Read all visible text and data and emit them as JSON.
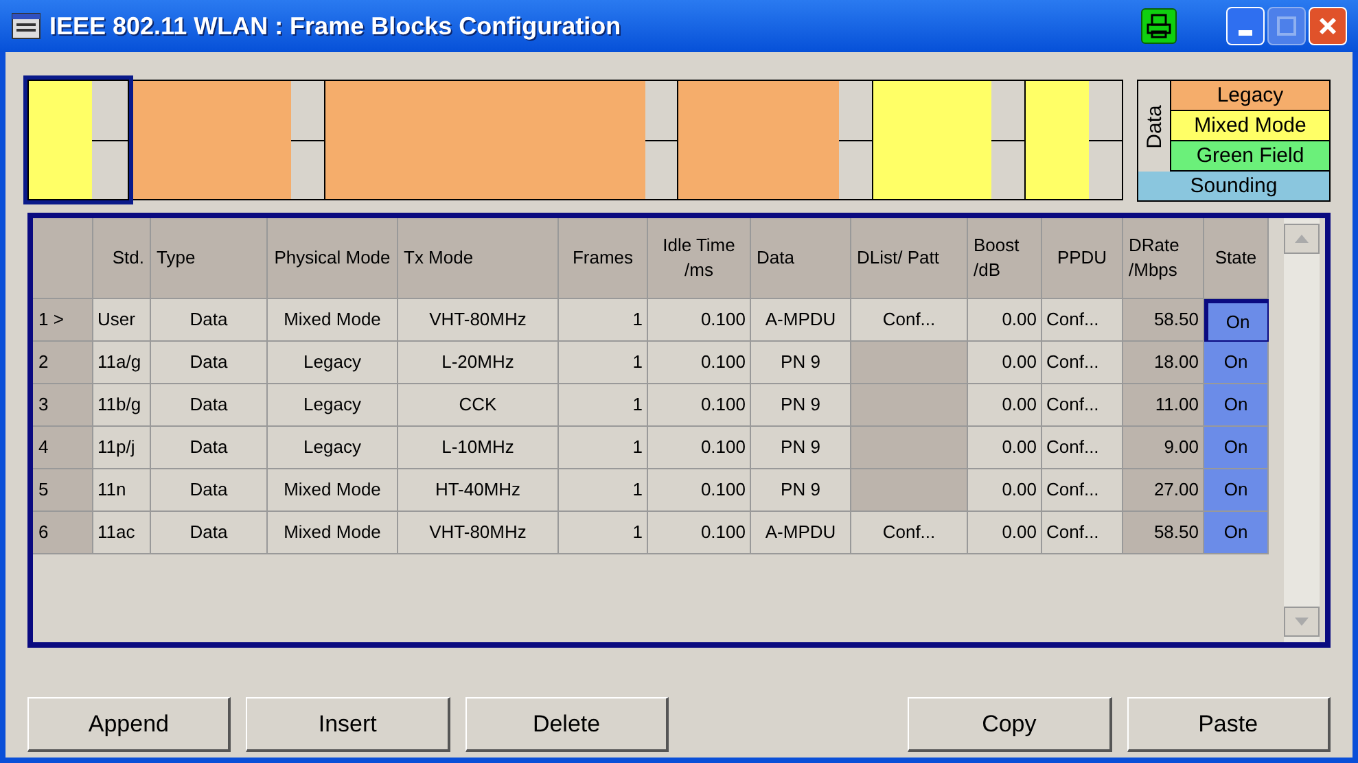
{
  "window": {
    "title": "IEEE 802.11 WLAN : Frame Blocks Configuration"
  },
  "frame_blocks": [
    {
      "color": "#ffff66",
      "selected": true
    },
    {
      "color": "#f5ad6b",
      "selected": false
    },
    {
      "color": "#f5ad6b",
      "selected": false
    },
    {
      "color": "#f5ad6b",
      "selected": false
    },
    {
      "color": "#ffff66",
      "selected": false
    },
    {
      "color": "#ffff66",
      "selected": false
    }
  ],
  "legend": {
    "group_label": "Data",
    "items": [
      {
        "label": "Legacy",
        "color": "#f5ad6b",
        "kind": "data"
      },
      {
        "label": "Mixed Mode",
        "color": "#ffff66",
        "kind": "data"
      },
      {
        "label": "Green Field",
        "color": "#6bf07a",
        "kind": "data"
      },
      {
        "label": "Sounding",
        "color": "#8ac6de",
        "kind": "other"
      }
    ]
  },
  "table": {
    "columns": [
      "Std.",
      "Type",
      "Physical Mode",
      "Tx Mode",
      "Frames",
      "Idle Time /ms",
      "Data",
      "DList/ Patt",
      "Boost /dB",
      "PPDU",
      "DRate /Mbps",
      "State"
    ],
    "rows": [
      {
        "label": "1 >",
        "selected": true,
        "std": "User",
        "type": "Data",
        "physical_mode": "Mixed Mode",
        "tx_mode": "VHT-80MHz",
        "frames": "1",
        "idle_time": "0.100",
        "data": "A-MPDU",
        "dlist_disabled": false,
        "dlist": "Conf...",
        "boost": "0.00",
        "ppdu": "Conf...",
        "drate": "58.50",
        "state": "On"
      },
      {
        "label": "2",
        "selected": false,
        "std": "11a/g",
        "type": "Data",
        "physical_mode": "Legacy",
        "tx_mode": "L-20MHz",
        "frames": "1",
        "idle_time": "0.100",
        "data": "PN 9",
        "dlist_disabled": true,
        "boost": "0.00",
        "ppdu": "Conf...",
        "drate": "18.00",
        "state": "On"
      },
      {
        "label": "3",
        "selected": false,
        "std": "11b/g",
        "type": "Data",
        "physical_mode": "Legacy",
        "tx_mode": "CCK",
        "frames": "1",
        "idle_time": "0.100",
        "data": "PN 9",
        "dlist_disabled": true,
        "boost": "0.00",
        "ppdu": "Conf...",
        "drate": "11.00",
        "state": "On"
      },
      {
        "label": "4",
        "selected": false,
        "std": "11p/j",
        "type": "Data",
        "physical_mode": "Legacy",
        "tx_mode": "L-10MHz",
        "frames": "1",
        "idle_time": "0.100",
        "data": "PN 9",
        "dlist_disabled": true,
        "boost": "0.00",
        "ppdu": "Conf...",
        "drate": "9.00",
        "state": "On"
      },
      {
        "label": "5",
        "selected": false,
        "std": "11n",
        "type": "Data",
        "physical_mode": "Mixed Mode",
        "tx_mode": "HT-40MHz",
        "frames": "1",
        "idle_time": "0.100",
        "data": "PN 9",
        "dlist_disabled": true,
        "boost": "0.00",
        "ppdu": "Conf...",
        "drate": "27.00",
        "state": "On"
      },
      {
        "label": "6",
        "selected": false,
        "std": "11ac",
        "type": "Data",
        "physical_mode": "Mixed Mode",
        "tx_mode": "VHT-80MHz",
        "frames": "1",
        "idle_time": "0.100",
        "data": "A-MPDU",
        "dlist_disabled": false,
        "dlist": "Conf...",
        "boost": "0.00",
        "ppdu": "Conf...",
        "drate": "58.50",
        "state": "On"
      }
    ]
  },
  "buttons": [
    "Append",
    "Insert",
    "Delete",
    "Copy",
    "Paste"
  ]
}
